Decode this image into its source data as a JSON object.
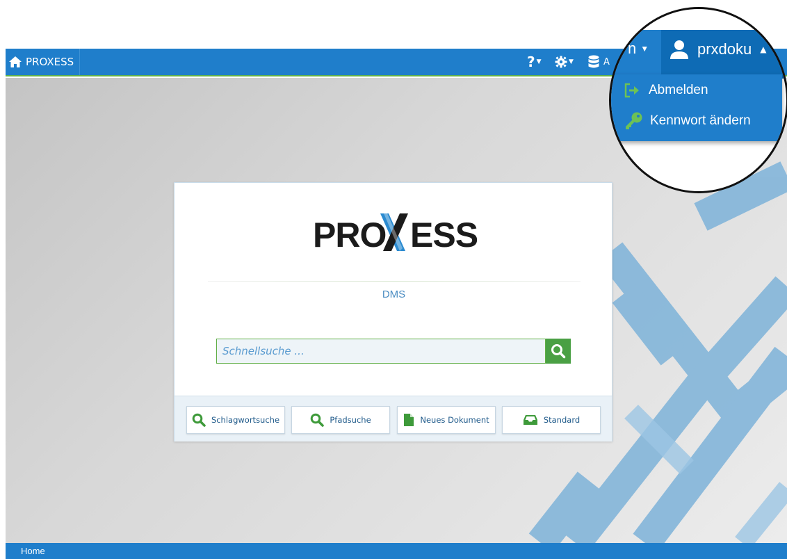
{
  "topbar": {
    "home_label": "PROXESS",
    "help_icon": "question-icon",
    "settings_icon": "gear-icon",
    "db_icon": "database-icon",
    "db_label_partial": "A"
  },
  "card": {
    "logo_text": "PROXESS",
    "product_label": "DMS",
    "search_placeholder": "Schnellsuche ..."
  },
  "quick_actions": [
    {
      "label": "Schlagwortsuche",
      "icon": "search-icon"
    },
    {
      "label": "Pfadsuche",
      "icon": "search-icon"
    },
    {
      "label": "Neues Dokument",
      "icon": "document-icon"
    },
    {
      "label": "Standard",
      "icon": "inbox-icon"
    }
  ],
  "statusbar": {
    "label": "Home"
  },
  "zoom_overlay": {
    "partial_menu_label": "n",
    "username": "prxdoku",
    "menu_items": [
      {
        "label": "Abmelden",
        "icon": "logout-icon"
      },
      {
        "label": "Kennwort ändern",
        "icon": "key-icon"
      }
    ]
  },
  "colors": {
    "brand_blue": "#1f7ecb",
    "accent_green": "#4aa044",
    "logo_dark": "#1b1b1b",
    "logo_blue": "#2a8ad0"
  }
}
